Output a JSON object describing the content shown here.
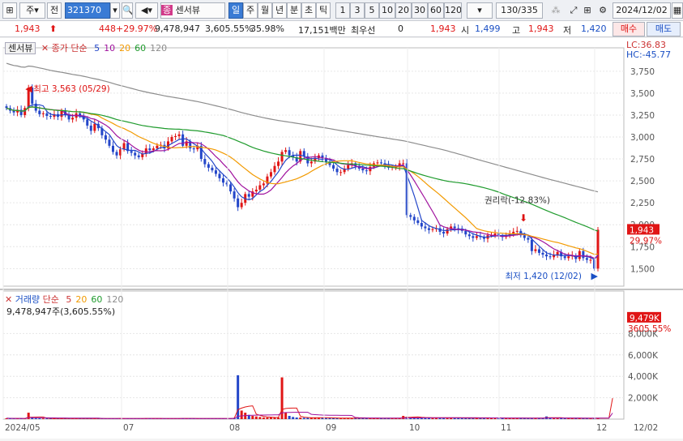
{
  "toolbar": {
    "market_label": "주",
    "prev_label": "전",
    "stock_code": "321370",
    "stock_name": "센서뷰",
    "stock_badge": "종",
    "periods": [
      "일",
      "주",
      "월",
      "년",
      "분",
      "초",
      "틱"
    ],
    "intervals": [
      "1",
      "3",
      "5",
      "10",
      "20",
      "30",
      "60",
      "120"
    ],
    "page_count": "130/335",
    "date": "2024/12/02"
  },
  "quote": {
    "price": "1,943",
    "change": "448",
    "change_pct": "+29.97%",
    "volume": "9,478,947",
    "volume_pct": "3,605.55%",
    "turnover_pct": "35.98%",
    "trade_value": "17,151백만",
    "priority_label": "최우선",
    "priority_value": "0",
    "priority_price": "1,943",
    "open_label": "시",
    "open": "1,499",
    "high_label": "고",
    "high": "1,943",
    "low_label": "저",
    "low": "1,420",
    "buy_label": "매수",
    "sell_label": "매도"
  },
  "chart": {
    "tab_label": "센서뷰",
    "legend_title": "종가 단순",
    "ma_periods": [
      "5",
      "10",
      "20",
      "60",
      "120"
    ],
    "ma_colors": [
      "#2346c9",
      "#a0129e",
      "#f29a00",
      "#1f9b2d",
      "#8c8c8c"
    ],
    "lc": "LC:36.83",
    "hc": "HC:-45.77",
    "high_annotation": "최고 3,563 (05/29)",
    "low_annotation": "최저 1,420 (12/02)",
    "rights_annotation": "권리락(-12.83%)",
    "price_tag": "1,943",
    "price_tag_pct": "29.97%",
    "volume_legend_title": "거래량",
    "volume_legend_sub": "단순",
    "volume_info": "9,478,947주(3,605.55%)",
    "volume_tag": "9,479K",
    "volume_tag_pct": "3605.55%",
    "x_labels": [
      "2024/05",
      "07",
      "08",
      "09",
      "10",
      "11",
      "12",
      "12/02"
    ]
  },
  "chart_data": {
    "type": "candlestick",
    "price_axis": [
      3750,
      3500,
      3250,
      3000,
      2750,
      2500,
      2250,
      2000,
      1750,
      1500
    ],
    "price_range": [
      1300,
      3850
    ],
    "volume_axis": [
      "8,000K",
      "6,000K",
      "4,000K",
      "2,000K"
    ],
    "volume_axis_values": [
      8000,
      6000,
      4000,
      2000
    ],
    "volume_range": [
      0,
      10000
    ],
    "closes": [
      3330,
      3300,
      3280,
      3310,
      3250,
      3330,
      3563,
      3380,
      3300,
      3260,
      3270,
      3240,
      3230,
      3260,
      3230,
      3300,
      3250,
      3200,
      3220,
      3270,
      3240,
      3200,
      3130,
      3070,
      3150,
      3100,
      3020,
      2970,
      2900,
      2830,
      2790,
      2860,
      2930,
      2840,
      2820,
      2790,
      2770,
      2810,
      2870,
      2850,
      2870,
      2900,
      2910,
      2870,
      2950,
      3000,
      3010,
      3030,
      2900,
      2950,
      2870,
      2860,
      2900,
      2750,
      2690,
      2650,
      2620,
      2580,
      2530,
      2480,
      2460,
      2380,
      2300,
      2200,
      2250,
      2350,
      2320,
      2380,
      2400,
      2450,
      2470,
      2550,
      2600,
      2670,
      2720,
      2830,
      2850,
      2790,
      2770,
      2720,
      2840,
      2780,
      2700,
      2720,
      2760,
      2790,
      2760,
      2720,
      2680,
      2640,
      2600,
      2600,
      2640,
      2680,
      2700,
      2670,
      2640,
      2620,
      2610,
      2660,
      2700,
      2710,
      2700,
      2680,
      2650,
      2660,
      2660,
      2700,
      2700,
      2110,
      2090,
      2050,
      2020,
      1980,
      1960,
      1940,
      1950,
      1960,
      1920,
      1900,
      1950,
      1980,
      1960,
      1940,
      1930,
      1890,
      1870,
      1850,
      1870,
      1860,
      1840,
      1880,
      1880,
      1900,
      1870,
      1860,
      1880,
      1900,
      1920,
      1930,
      1880,
      1850,
      1830,
      1700,
      1720,
      1680,
      1660,
      1640,
      1630,
      1660,
      1690,
      1640,
      1620,
      1640,
      1650,
      1610,
      1700,
      1620,
      1600,
      1600,
      1500,
      1943
    ],
    "volumes": [
      80,
      70,
      60,
      60,
      55,
      60,
      600,
      150,
      90,
      80,
      70,
      70,
      60,
      60,
      55,
      60,
      60,
      60,
      60,
      60,
      60,
      60,
      60,
      60,
      60,
      60,
      55,
      70,
      60,
      60,
      55,
      80,
      55,
      55,
      60,
      60,
      70,
      60,
      80,
      70,
      60,
      55,
      60,
      60,
      60,
      60,
      60,
      70,
      80,
      60,
      60,
      60,
      60,
      70,
      60,
      60,
      55,
      60,
      60,
      60,
      60,
      80,
      120,
      4100,
      800,
      600,
      400,
      300,
      250,
      200,
      150,
      150,
      150,
      150,
      150,
      3900,
      600,
      300,
      200,
      150,
      150,
      120,
      120,
      150,
      150,
      120,
      120,
      100,
      110,
      100,
      100,
      90,
      90,
      100,
      110,
      100,
      90,
      80,
      80,
      80,
      90,
      80,
      80,
      80,
      80,
      80,
      90,
      100,
      300,
      220,
      180,
      160,
      150,
      140,
      130,
      130,
      120,
      120,
      110,
      130,
      140,
      120,
      110,
      110,
      100,
      100,
      100,
      100,
      100,
      100,
      120,
      120,
      110,
      100,
      100,
      100,
      100,
      100,
      100,
      100,
      90,
      90,
      100,
      100,
      100,
      90,
      90,
      250,
      150,
      110,
      90,
      80,
      80,
      80,
      90,
      80,
      80,
      80,
      80,
      70,
      100,
      80,
      80,
      80,
      100,
      9479
    ]
  }
}
